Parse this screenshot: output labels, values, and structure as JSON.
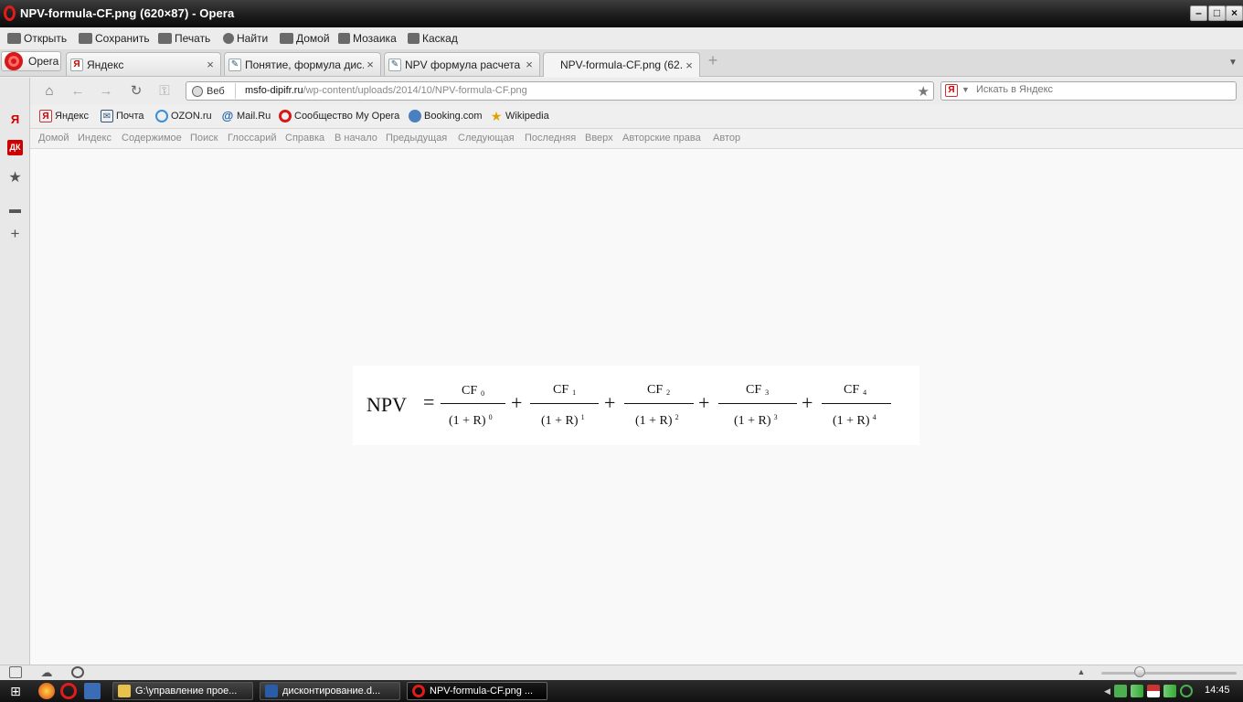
{
  "window": {
    "title": "NPV-formula-CF.png (620×87) - Opera"
  },
  "menu": {
    "items": [
      {
        "label": "Открыть",
        "icon": "folder-icon"
      },
      {
        "label": "Сохранить",
        "icon": "save-icon"
      },
      {
        "label": "Печать",
        "icon": "print-icon"
      },
      {
        "label": "Найти",
        "icon": "search-icon"
      },
      {
        "label": "Домой",
        "icon": "home-icon"
      },
      {
        "label": "Мозаика",
        "icon": "tile-icon"
      },
      {
        "label": "Каскад",
        "icon": "cascade-icon"
      }
    ]
  },
  "tabs": {
    "opera_button": "Opera",
    "items": [
      {
        "label": "Яндекс",
        "active": false
      },
      {
        "label": "Понятие, формула дис...",
        "active": false
      },
      {
        "label": "NPV формула расчета п...",
        "active": false
      },
      {
        "label": "NPV-formula-CF.png (62...",
        "active": true
      }
    ]
  },
  "address": {
    "web_label": "Веб",
    "url_host": "msfo-dipifr.ru",
    "url_path": "/wp-content/uploads/2014/10/NPV-formula-CF.png",
    "search_placeholder": "Искать в Яндекс"
  },
  "bookmarks": [
    {
      "label": "Яндекс"
    },
    {
      "label": "Почта"
    },
    {
      "label": "OZON.ru"
    },
    {
      "label": "Mail.Ru"
    },
    {
      "label": "Сообщество My Opera"
    },
    {
      "label": "Booking.com"
    },
    {
      "label": "Wikipedia"
    }
  ],
  "navlinks": [
    "Домой",
    "Индекс",
    "Содержимое",
    "Поиск",
    "Глоссарий",
    "Справка",
    "В начало",
    "Предыдущая",
    "Следующая",
    "Последняя",
    "Вверх",
    "Авторские права",
    "Автор"
  ],
  "formula": {
    "lhs": "NPV",
    "eq": "=",
    "plus": "+",
    "terms": [
      {
        "num": "CF",
        "num_sub": "0",
        "den": "(1 + R)",
        "den_sup": "0"
      },
      {
        "num": "CF",
        "num_sub": "1",
        "den": "(1 + R)",
        "den_sup": "1"
      },
      {
        "num": "CF",
        "num_sub": "2",
        "den": "(1 + R)",
        "den_sup": "2"
      },
      {
        "num": "CF",
        "num_sub": "3",
        "den": "(1 + R)",
        "den_sup": "3"
      },
      {
        "num": "CF",
        "num_sub": "4",
        "den": "(1 + R)",
        "den_sup": "4"
      }
    ]
  },
  "taskbar": {
    "tasks": [
      {
        "label": "G:\\управление прое..."
      },
      {
        "label": "дисконтирование.d..."
      },
      {
        "label": "NPV-formula-CF.png ..."
      }
    ],
    "clock": "14:45"
  }
}
